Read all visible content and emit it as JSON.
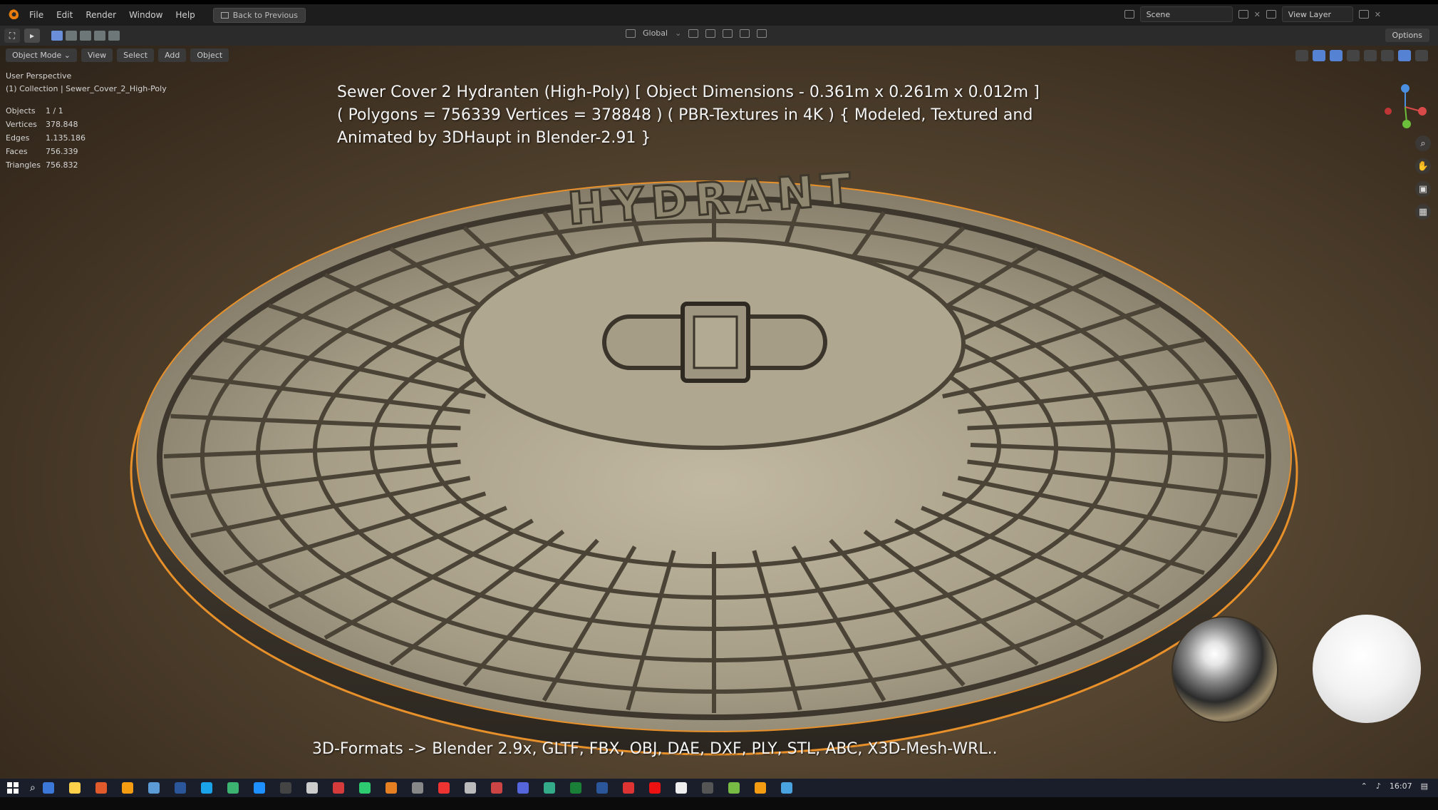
{
  "menubar": {
    "items": [
      "File",
      "Edit",
      "Render",
      "Window",
      "Help"
    ],
    "back_button": "Back to Previous",
    "scene": "Scene",
    "view_layer": "View Layer"
  },
  "toolbar": {
    "transform_orientation": "Global",
    "options": "Options"
  },
  "viewport_header": {
    "mode": "Object Mode",
    "menus": [
      "View",
      "Select",
      "Add",
      "Object"
    ]
  },
  "overlay": {
    "perspective": "User Perspective",
    "collection": "(1) Collection | Sewer_Cover_2_High-Poly"
  },
  "stats": [
    {
      "label": "Objects",
      "value": "1 / 1"
    },
    {
      "label": "Vertices",
      "value": "378.848"
    },
    {
      "label": "Edges",
      "value": "1.135.186"
    },
    {
      "label": "Faces",
      "value": "756.339"
    },
    {
      "label": "Triangles",
      "value": "756.832"
    }
  ],
  "caption": {
    "line1": "Sewer Cover 2 Hydranten (High-Poly) [ Object Dimensions -  0.361m x 0.261m x 0.012m ]",
    "line2": "( Polygons = 756339 Vertices = 378848 ) ( PBR-Textures in 4K ) { Modeled, Textured and",
    "line3": "Animated by 3DHaupt in Blender-2.91 }",
    "formats": "3D-Formats -> Blender 2.9x, GLTF, FBX, OBJ, DAE, DXF, PLY, STL, ABC, X3D-Mesh-WRL.."
  },
  "model": {
    "embossed_text": "HYDRANT",
    "metal_color": "#a9a08a",
    "outline_color": "#e8902a"
  },
  "taskbar": {
    "time": "16:07",
    "icon_colors": [
      "#3c78d8",
      "#ffd04a",
      "#e05a2b",
      "#f39c12",
      "#5c9bd6",
      "#2b579a",
      "#1aa3e8",
      "#3cb371",
      "#1e90ff",
      "#444",
      "#ccc",
      "#d63b3b",
      "#2ecc71",
      "#e67e22",
      "#888",
      "#e33",
      "#bbb",
      "#c44",
      "#5566dd",
      "#3a8",
      "#1a7f37",
      "#2b579a",
      "#d33",
      "#e11",
      "#eee",
      "#555",
      "#7b4",
      "#f39c12",
      "#4aa3df"
    ]
  }
}
